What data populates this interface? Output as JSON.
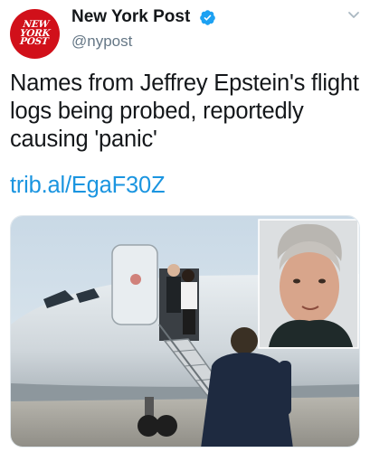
{
  "account": {
    "avatar_logo_lines": [
      "NEW",
      "YORK",
      "POST"
    ],
    "display_name": "New York Post",
    "handle": "@nypost",
    "verified": true
  },
  "tweet": {
    "text": "Names from Jeffrey Epstein's flight logs being probed, reportedly causing 'panic'",
    "link": "trib.al/EgaF30Z"
  },
  "media": {
    "main_photo": "private-jet-boarding-photo",
    "inset_photo": "mugshot-portrait"
  },
  "colors": {
    "brand_red": "#d1101a",
    "verified_blue": "#1da1f2",
    "link_blue": "#1b95e0",
    "text": "#14171a",
    "secondary": "#657786"
  },
  "icons": {
    "verified": "verified-badge-icon",
    "menu": "chevron-down-icon"
  }
}
